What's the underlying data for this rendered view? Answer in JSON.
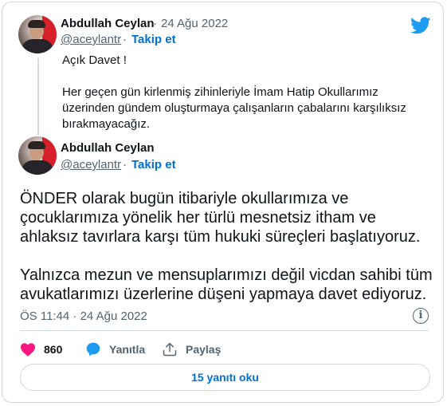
{
  "quoted_tweet": {
    "author_name": "Abdullah Ceylan",
    "separator": "·",
    "date": "24 Ağu 2022",
    "handle": "@aceylantr",
    "follow_label": "Takip et",
    "line1": "Açık Davet !",
    "line2": "Her geçen gün kirlenmiş zihinleriyle İmam Hatip Okullarımız üzerinden gündem oluşturmaya çalışanların çabalarını karşılıksız bırakmayacağız."
  },
  "main_tweet": {
    "author_name": "Abdullah Ceylan",
    "handle": "@aceylantr",
    "separator": "·",
    "follow_label": "Takip et",
    "paragraph1": "ÖNDER olarak bugün itibariyle okullarımıza ve çocuklarımıza yönelik her türlü mesnetsiz itham ve ahlaksız tavırlara karşı tüm hukuki süreçleri başlatıyoruz.",
    "paragraph2": "Yalnızca mezun ve mensuplarımızı değil vicdan sahibi tüm avukatlarımızı üzerlerine düşeni yapmaya davet ediyoruz.",
    "timestamp": "ÖS 11:44 · 24 Ağu 2022"
  },
  "actions": {
    "like_count": "860",
    "reply_label": "Yanıtla",
    "share_label": "Paylaş"
  },
  "read_replies_label": "15 yanıtı oku",
  "icons": {
    "logo": "twitter-bird-icon",
    "info": "info-icon",
    "like": "heart-icon",
    "reply": "speech-bubble-icon",
    "share": "share-upload-icon"
  },
  "colors": {
    "accent": "#1d9bf0",
    "link": "#006fd6",
    "like": "#f91880",
    "muted": "#536471",
    "border": "#cfd9de"
  }
}
